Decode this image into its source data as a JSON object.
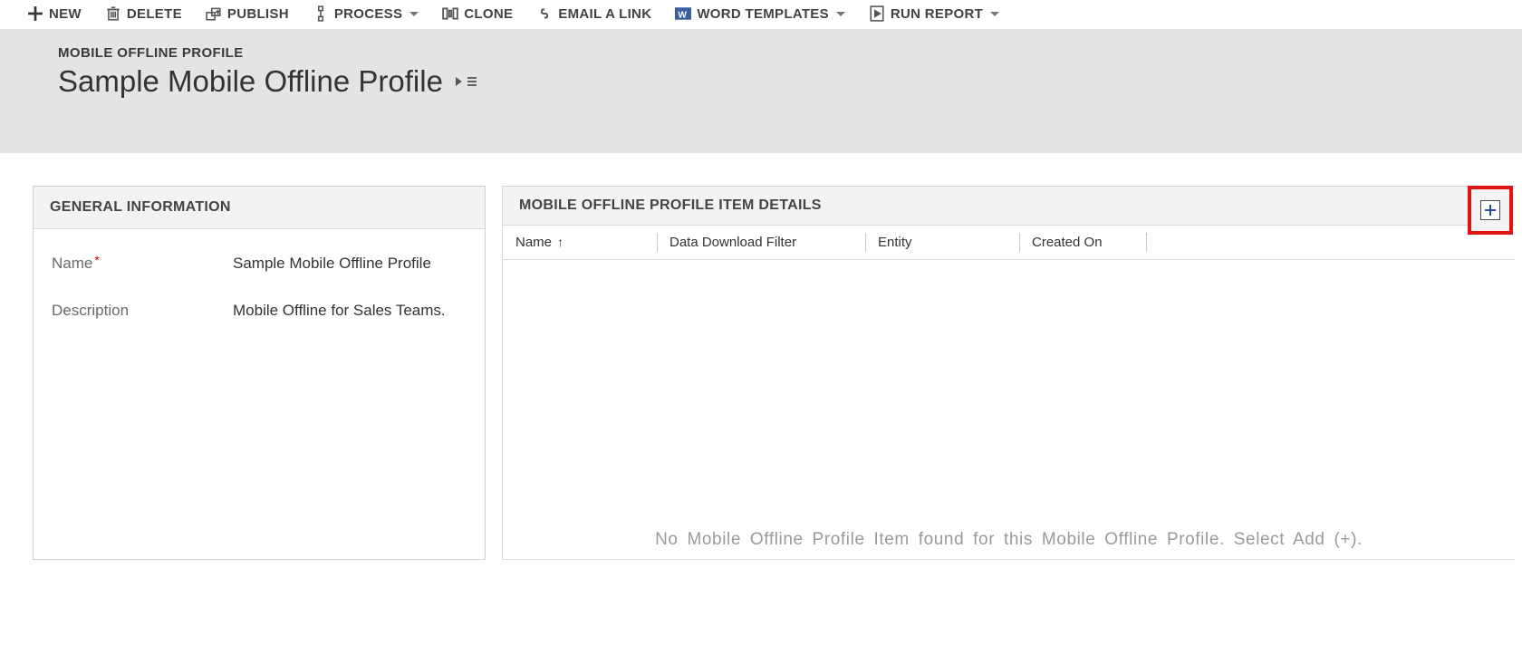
{
  "commands": {
    "new": "NEW",
    "delete": "DELETE",
    "publish": "PUBLISH",
    "process": "PROCESS",
    "clone": "CLONE",
    "email_link": "EMAIL A LINK",
    "word_templates": "WORD TEMPLATES",
    "run_report": "RUN REPORT"
  },
  "header": {
    "entity_type": "MOBILE OFFLINE PROFILE",
    "record_title": "Sample Mobile Offline Profile"
  },
  "general": {
    "section_title": "GENERAL INFORMATION",
    "name_label": "Name",
    "name_value": "Sample Mobile Offline Profile",
    "description_label": "Description",
    "description_value": "Mobile Offline for Sales Teams."
  },
  "detail_grid": {
    "section_title": "MOBILE OFFLINE PROFILE ITEM DETAILS",
    "columns": {
      "name": "Name",
      "filter": "Data Download Filter",
      "entity": "Entity",
      "created": "Created On"
    },
    "empty_message": "No Mobile Offline Profile Item found for this Mobile Offline Profile. Select Add (+)."
  }
}
